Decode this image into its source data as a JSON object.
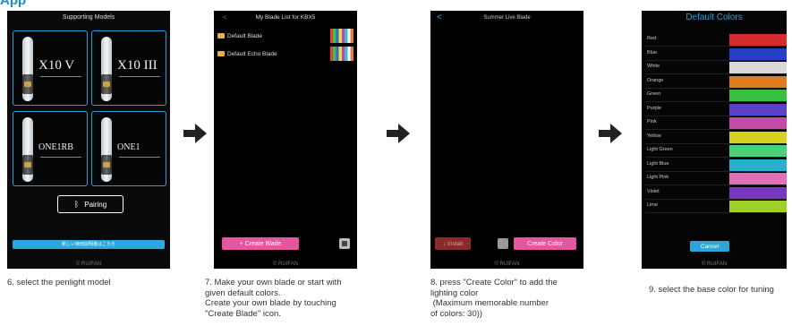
{
  "heading": "App",
  "colors": {
    "accent": "#2a9fd6",
    "pink": "#e6559f",
    "arrow": "#222222"
  },
  "screen1": {
    "title": "Supporting Models",
    "models": [
      "X10 V",
      "X10 III",
      "ONE1RB",
      "ONE1"
    ],
    "pairing_label": "Pairing",
    "bluetooth_icon": "bluetooth-icon",
    "bottom_bar": "新しい使用説明書はこちら",
    "brand": "© RUIFAN",
    "caption": "6. select the penlight model"
  },
  "screen2": {
    "title": "My Blade List for KBX5",
    "back": "<",
    "blades": [
      "Default Blade",
      "Default Echo Blade"
    ],
    "create_button": "+ Create Blade",
    "brand": "© RUIFAN",
    "caption": [
      "7. Make your own blade or start with",
      "given default colors.",
      "Create your own blade by touching",
      "\"Create Blade\" icon."
    ]
  },
  "screen3": {
    "title": "Summer Live Blade",
    "back": "<",
    "install_button": "↓ Install",
    "create_button": "Create Color",
    "brand": "© RUIFAN",
    "caption": [
      "8. press \"Create Color\" to add the",
      "lighting color",
      " (Maximum memorable number",
      "of colors: 30))"
    ]
  },
  "screen4": {
    "title": "Default Colors",
    "colors": [
      {
        "name": "Red",
        "hex": "#d62b2b"
      },
      {
        "name": "Blue",
        "hex": "#2440c8"
      },
      {
        "name": "White",
        "hex": "#d9d9d9"
      },
      {
        "name": "Orange",
        "hex": "#e07a20"
      },
      {
        "name": "Green",
        "hex": "#38c040"
      },
      {
        "name": "Purple",
        "hex": "#5c40c8"
      },
      {
        "name": "Pink",
        "hex": "#c44aa8"
      },
      {
        "name": "Yellow",
        "hex": "#d8d020"
      },
      {
        "name": "Light Green",
        "hex": "#48d07a"
      },
      {
        "name": "Light Blue",
        "hex": "#28b0d0"
      },
      {
        "name": "Light Pink",
        "hex": "#e070b8"
      },
      {
        "name": "Violet",
        "hex": "#7838c0"
      },
      {
        "name": "Lime",
        "hex": "#a0d028"
      }
    ],
    "cancel_label": "Cancel",
    "brand": "© RUIFAN",
    "caption": "9. select the base color for tuning"
  }
}
